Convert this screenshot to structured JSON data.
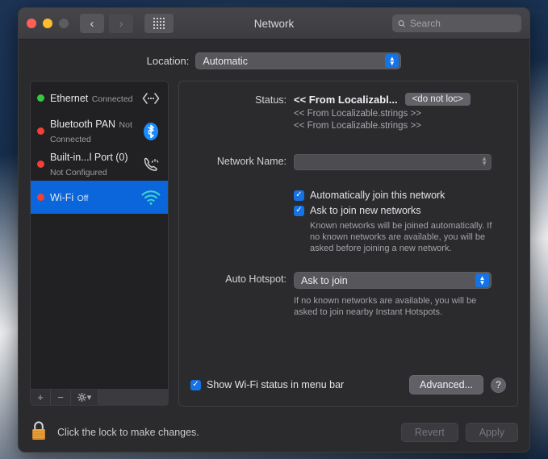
{
  "window": {
    "title": "Network",
    "traffic_lights": [
      "close-red",
      "minimize-yellow",
      "zoom-gray-disabled"
    ],
    "nav": {
      "back": "‹",
      "forward": "›",
      "grid": "grid-view-icon"
    },
    "search": {
      "placeholder": "Search",
      "value": ""
    }
  },
  "location": {
    "label": "Location:",
    "selected": "Automatic",
    "options": [
      "Automatic"
    ]
  },
  "sidebar": {
    "interfaces": [
      {
        "name": "Ethernet",
        "status": "Connected",
        "dot": "green",
        "icon": "ethernet-icon",
        "selected": false
      },
      {
        "name": "Bluetooth PAN",
        "status": "Not Connected",
        "dot": "red",
        "icon": "bluetooth-icon",
        "selected": false
      },
      {
        "name": "Built-in...l Port (0)",
        "status": "Not Configured",
        "dot": "red",
        "icon": "modem-phone-icon",
        "selected": false
      },
      {
        "name": "Wi-Fi",
        "status": "Off",
        "dot": "red",
        "icon": "wifi-icon",
        "selected": true
      }
    ],
    "toolbar": {
      "add": "+",
      "remove": "−",
      "actions": "gear-icon"
    }
  },
  "panel": {
    "status": {
      "label": "Status:",
      "value": "<< From Localizabl...",
      "badge": "<do not loc>",
      "sub_lines": [
        "<< From Localizable.strings >>",
        "<< From Localizable.strings >>"
      ]
    },
    "network_name": {
      "label": "Network Name:",
      "value": ""
    },
    "checkboxes": [
      {
        "label": "Automatically join this network",
        "checked": true
      },
      {
        "label": "Ask to join new networks",
        "checked": true
      }
    ],
    "join_help": "Known networks will be joined automatically. If no known networks are available, you will be asked before joining a new network.",
    "auto_hotspot": {
      "label": "Auto Hotspot:",
      "selected": "Ask to join",
      "help": "If no known networks are available, you will be asked to join nearby Instant Hotspots."
    },
    "menubar_checkbox": {
      "label": "Show Wi-Fi status in menu bar",
      "checked": true
    },
    "advanced_button": "Advanced...",
    "help_button": "?"
  },
  "footer": {
    "lock_icon": "lock-closed-icon",
    "lock_text": "Click the lock to make changes.",
    "revert": "Revert",
    "apply": "Apply"
  },
  "colors": {
    "accent_blue": "#1573e6",
    "selection_blue": "#0a66da",
    "window_bg": "#2b2b2e",
    "sidebar_bg": "#212123",
    "status_green": "#36c93f",
    "status_red": "#ef4136"
  }
}
